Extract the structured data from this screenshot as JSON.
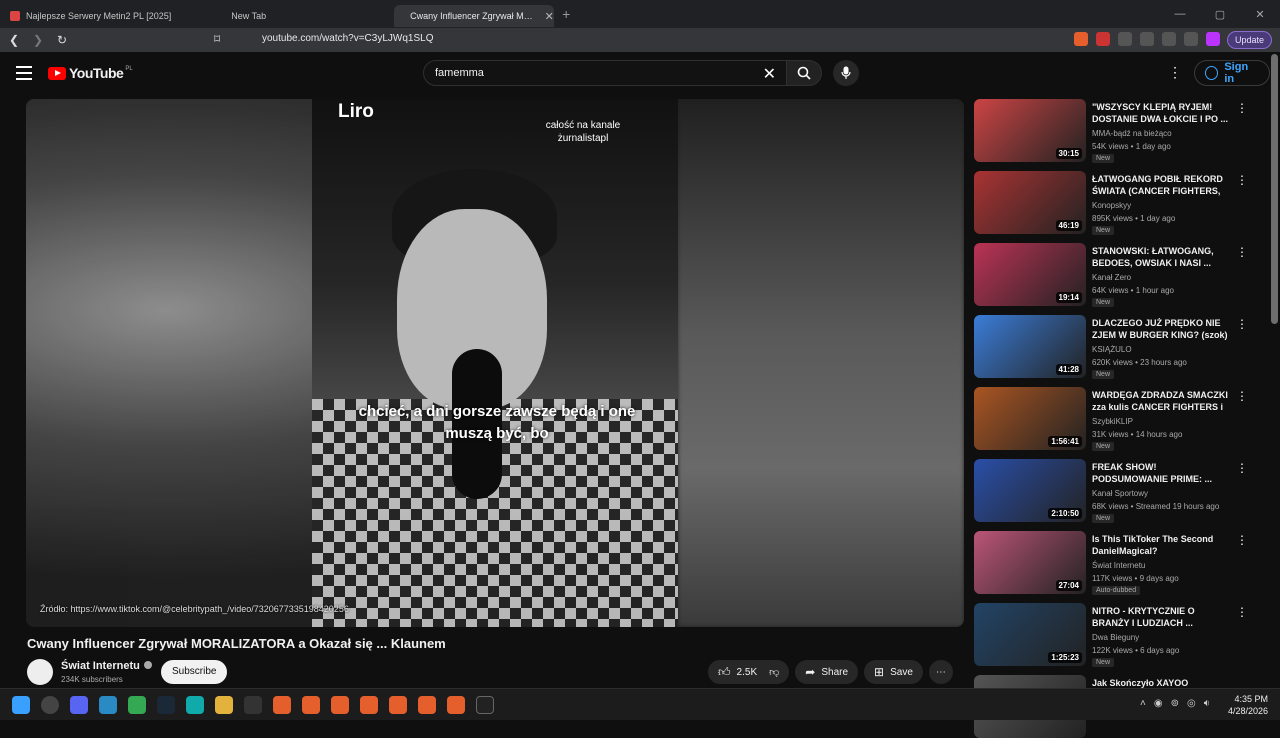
{
  "browser": {
    "tabs": [
      {
        "label": "Najlepsze Serwery Metin2 PL [2025]",
        "active": false
      },
      {
        "label": "New Tab",
        "active": false
      },
      {
        "label": "Cwany Influencer Zgrywał M…",
        "active": true
      }
    ],
    "url": "youtube.com/watch?v=C3yLJWq1SLQ",
    "update_label": "Update",
    "notif_count": "1"
  },
  "header": {
    "logo_text": "YouTube",
    "logo_country": "PL",
    "search_value": "famemma",
    "signin_label": "Sign in"
  },
  "video": {
    "overlay_name": "Liro",
    "overlay_note": "całość na kanale żurnalistapl",
    "caption": "chcieć, a dni gorsze zawsze będą i one muszą być, bo",
    "source": "Źródło: https://www.tiktok.com/@celebritypath_/video/7320677335198420256",
    "title": "Cwany Influencer Zgrywał MORALIZATORA a Okazał się ... Klaunem",
    "channel": "Świat Internetu",
    "subscribers": "234K subscribers",
    "subscribe_label": "Subscribe",
    "likes": "2.5K",
    "share_label": "Share",
    "save_label": "Save"
  },
  "recommendations": [
    {
      "title": "\"WSZYSCY KLEPIĄ RYJEM! DOSTANIE DWA ŁOKCIE I PO ...",
      "channel": "MMA-bądź na bieżąco",
      "meta": "54K views • 1 day ago",
      "badge": "New",
      "duration": "30:15",
      "color": "#c44"
    },
    {
      "title": "ŁATWOGANG POBIŁ REKORD ŚWIATA (CANCER FIGHTERS, ...",
      "channel": "Konopskyy",
      "meta": "895K views • 1 day ago",
      "badge": "New",
      "duration": "46:19",
      "color": "#a33"
    },
    {
      "title": "STANOWSKI: ŁATWOGANG, BEDOES, OWSIAK I NASI ...",
      "channel": "Kanał Zero",
      "meta": "64K views • 1 hour ago",
      "badge": "New",
      "duration": "19:14",
      "color": "#b35"
    },
    {
      "title": "DLACZEGO JUŻ PRĘDKO NIE ZJEM W BURGER KING? (szok)",
      "channel": "KSIĄŻULO",
      "meta": "620K views • 23 hours ago",
      "badge": "New",
      "duration": "41:28",
      "color": "#3b7dd8"
    },
    {
      "title": "WARDĘGA ZDRADZA SMACZKI zza kulis CANCER FIGHTERS i ...",
      "channel": "SzybkiKLIP",
      "meta": "31K views • 14 hours ago",
      "badge": "New",
      "duration": "1:56:41",
      "color": "#a52"
    },
    {
      "title": "FREAK SHOW! PODSUMOWANIE PRIME: ...",
      "channel": "Kanał Sportowy",
      "meta": "68K views • Streamed 19 hours ago",
      "badge": "New",
      "duration": "2:10:50",
      "color": "#2a4fa8"
    },
    {
      "title": "Is This TikToker The Second DanielMagical?",
      "channel": "Świat Internetu",
      "meta": "117K views • 9 days ago",
      "badge": "Auto-dubbed",
      "duration": "27:04",
      "color": "#b57"
    },
    {
      "title": "NITRO - KRYTYCZNIE O BRANŻY I LUDZIACH ...",
      "channel": "Dwa Bieguny",
      "meta": "122K views • 6 days ago",
      "badge": "New",
      "duration": "1:25:23",
      "color": "#246"
    },
    {
      "title": "Jak Skończyło XAYOO",
      "channel": "",
      "meta": "",
      "badge": "",
      "duration": "",
      "color": "#555"
    }
  ],
  "taskbar": {
    "time": "4:35 PM",
    "date": "4/28/2026"
  }
}
